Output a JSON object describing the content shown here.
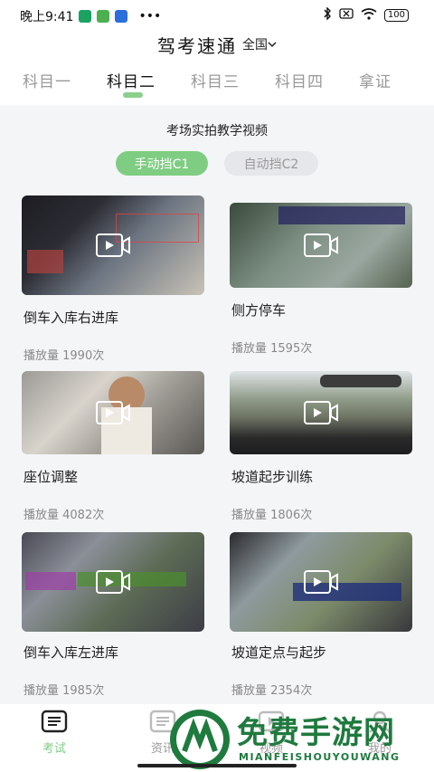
{
  "status_bar": {
    "time": "晚上9:41",
    "dots": "•••",
    "battery": "100"
  },
  "header": {
    "title": "驾考速通",
    "region": "全国"
  },
  "tabs": [
    {
      "label": "科目一"
    },
    {
      "label": "科目二"
    },
    {
      "label": "科目三"
    },
    {
      "label": "科目四"
    },
    {
      "label": "拿证"
    }
  ],
  "section": {
    "title": "考场实拍教学视频",
    "filters": [
      "手动挡C1",
      "自动挡C2"
    ]
  },
  "videos": [
    {
      "title": "倒车入库右进库",
      "views": "播放量 1990次"
    },
    {
      "title": "侧方停车",
      "views": "播放量 1595次"
    },
    {
      "title": "座位调整",
      "views": "播放量 4082次"
    },
    {
      "title": "坡道起步训练",
      "views": "播放量 1806次"
    },
    {
      "title": "倒车入库左进库",
      "views": "播放量 1985次"
    },
    {
      "title": "坡道定点与起步",
      "views": "播放量 2354次"
    }
  ],
  "bottom_nav": [
    {
      "label": "考试",
      "icon": "exam-icon"
    },
    {
      "label": "资讯",
      "icon": "news-icon"
    },
    {
      "label": "视频",
      "icon": "video-icon"
    },
    {
      "label": "我的",
      "icon": "profile-icon"
    }
  ],
  "watermark": {
    "text": "免费手游网",
    "sub": "MIANFEISHOUYOUWANG"
  },
  "colors": {
    "accent": "#7fcd82",
    "background": "#f4f5f7",
    "watermark": "#1f7a3e"
  }
}
